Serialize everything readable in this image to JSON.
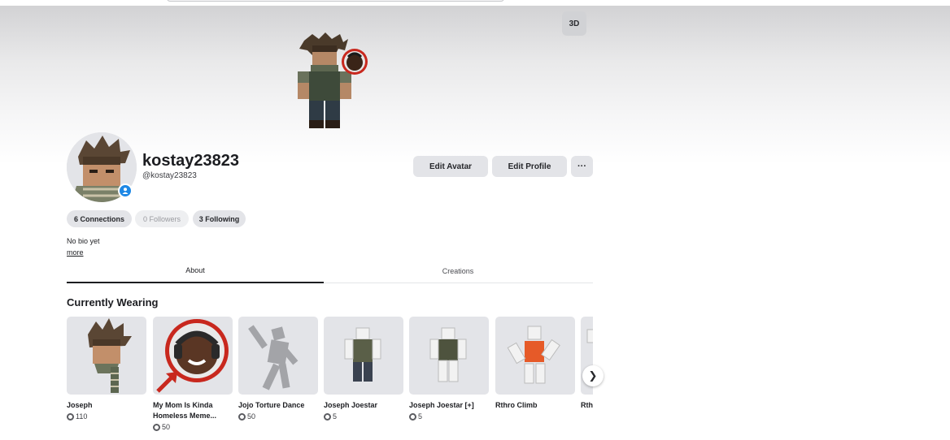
{
  "banner": {
    "btn_3d": "3D"
  },
  "profile": {
    "display_name": "kostay23823",
    "username": "@kostay23823",
    "edit_avatar": "Edit Avatar",
    "edit_profile": "Edit Profile",
    "more_actions": "···",
    "connections": "6 Connections",
    "followers": "0 Followers",
    "following": "3 Following",
    "bio": "No bio yet",
    "bio_more": "more"
  },
  "tabs": {
    "about": "About",
    "creations": "Creations",
    "active": "About"
  },
  "wearing": {
    "title": "Currently Wearing",
    "items": [
      {
        "name": "Joseph",
        "price": "110",
        "thumb": "head-icon"
      },
      {
        "name": "My Mom Is Kinda Homeless Meme...",
        "price": "50",
        "thumb": "meme-face-icon"
      },
      {
        "name": "Jojo Torture Dance",
        "price": "50",
        "thumb": "dance-emote-icon"
      },
      {
        "name": "Joseph Joestar",
        "price": "5",
        "thumb": "outfit-icon"
      },
      {
        "name": "Joseph Joestar [+]",
        "price": "5",
        "thumb": "outfit-icon"
      },
      {
        "name": "Rthro Climb",
        "price": "",
        "thumb": "climb-animation-icon"
      },
      {
        "name": "Rth",
        "price": "",
        "thumb": "partial-item-icon"
      }
    ],
    "next_icon": "chevron-right-icon"
  },
  "colors": {
    "accent": "#1e88e5",
    "pill_bg": "#e3e4e8",
    "meme_ring": "#c8281e"
  }
}
